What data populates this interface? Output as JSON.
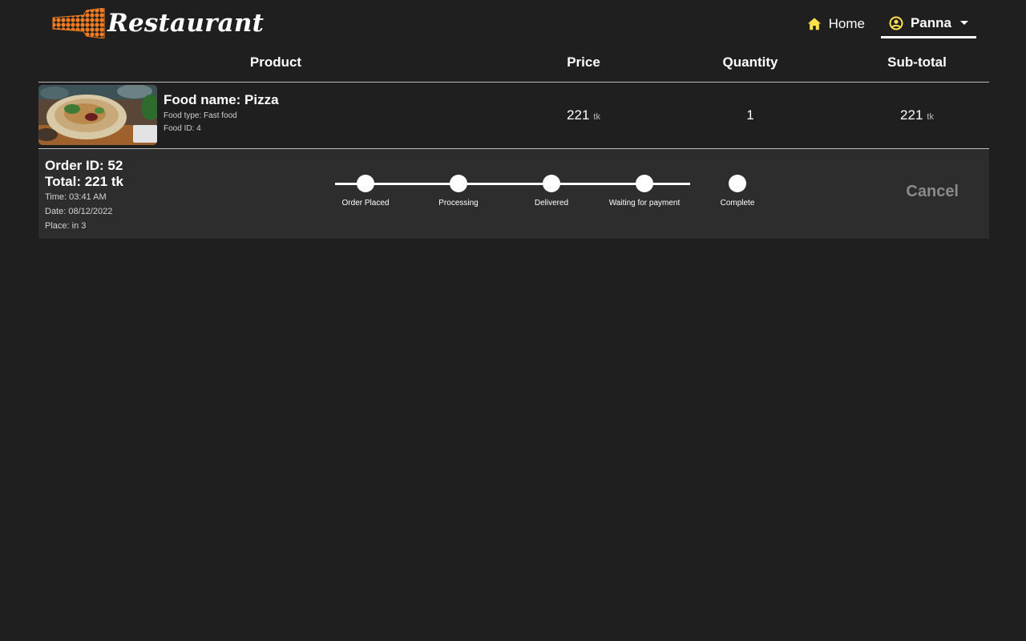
{
  "brand": {
    "name": "Restaurant",
    "logo_icon": "bottle-logo",
    "logo_color": "#f47b20"
  },
  "nav": {
    "home": {
      "label": "Home",
      "icon": "home-icon"
    },
    "user": {
      "label": "Panna",
      "icon": "user-circle-icon"
    },
    "icon_color": "#ffe14d"
  },
  "cart": {
    "columns": {
      "product": "Product",
      "price": "Price",
      "quantity": "Quantity",
      "subtotal": "Sub-total"
    },
    "items": [
      {
        "food_name": "Food name: Pizza",
        "food_type": "Food type: Fast food",
        "food_id": "Food ID: 4",
        "price": "221",
        "price_unit": "tk",
        "quantity": "1",
        "subtotal": "221",
        "subtotal_unit": "tk"
      }
    ]
  },
  "order": {
    "id": "Order ID: 52",
    "total": "Total: 221 tk",
    "time": "Time: 03:41 AM",
    "date": "Date: 08/12/2022",
    "place": "Place: in 3",
    "steps": [
      "Order Placed",
      "Processing",
      "Delivered",
      "Waiting for payment",
      "Complete"
    ],
    "cancel_label": "Cancel"
  }
}
